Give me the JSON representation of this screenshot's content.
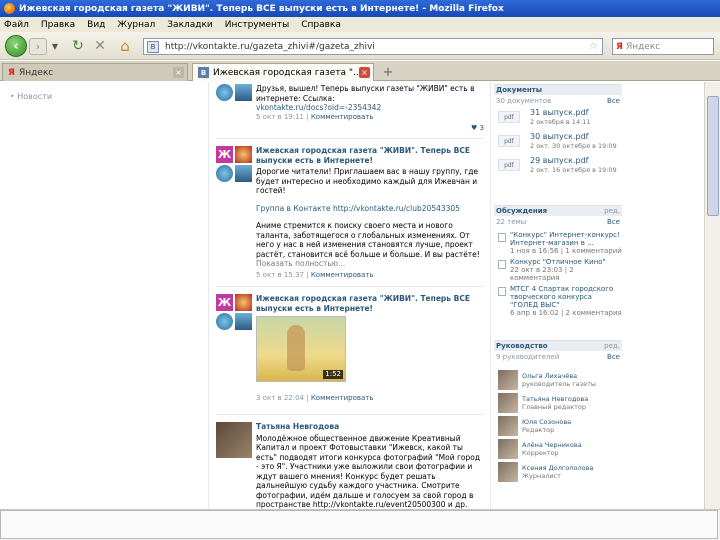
{
  "window": {
    "title": "Ижевская городская газета \"ЖИВИ\". Теперь ВСЕ выпуски есть в Интернете! - Mozilla Firefox"
  },
  "menu": [
    "Файл",
    "Правка",
    "Вид",
    "Журнал",
    "Закладки",
    "Инструменты",
    "Справка"
  ],
  "nav": {
    "url": "http://vkontakte.ru/gazeta_zhivi#/gazeta_zhivi",
    "search_placeholder": "Яндекс",
    "search_logo": "Я"
  },
  "tabs": [
    {
      "label": "Яндекс",
      "active": false
    },
    {
      "label": "Ижевская городская газета \"...",
      "active": true
    }
  ],
  "leftnav": {
    "label": "Новости"
  },
  "posts": [
    {
      "author": "",
      "text": "Друзья, вышел! Теперь выпуски газеты \"ЖИВИ\" есть в интернете: Ссылка:",
      "link": "vkontakte.ru/docs?oid=-2354342",
      "meta_date": "5 окт в 19:11",
      "meta_action": "Комментировать",
      "likes": "3"
    },
    {
      "author": "Ижевская городская газета \"ЖИВИ\". Теперь ВСЕ выпуски есть в Интернете!",
      "text1": "Дорогие читатели! Приглашаем вас в нашу группу, где будет интересно и необходимо каждый для Ижевчан и гостей!",
      "text2": "Группа в Контакте http://vkontakte.ru/club20543305",
      "text3": "Аниме стремится к поиску своего места и нового таланта, заботящегося о глобальных изменениях. От него у нас в ней изменения становятся лучше, проект растёт, становится всё больше и больше. И вы растёте!",
      "more": "Показать полностью...",
      "meta_date": "5 окт в 15:37",
      "meta_action": "Комментировать"
    },
    {
      "author": "Ижевская городская газета \"ЖИВИ\". Теперь ВСЕ выпуски есть в Интернете!",
      "video_duration": "1:52",
      "meta_date": "3 окт в 22:04",
      "meta_action": "Комментировать"
    },
    {
      "author": "Татьяна Невгодова",
      "text": "Молодёжное общественное движение Креативный Капитал и проект Фотовыставки \"Ижевск, какой ты есть\" подводят итоги конкурса фотографий \"Мой город - это Я\". Участники уже выложили свои фотографии и ждут вашего мнения! Конкурс будет решать дальнейшую судьбу каждого участника. Смотрите фотографии, идём дальше и голосуем за свой город в пространстве http://vkontakte.ru/event20500300 и др.",
      "meta_date": "",
      "meta_action": ""
    }
  ],
  "sidebar": {
    "documents": {
      "title": "Документы",
      "all": "Все",
      "count": "30 документов",
      "items": [
        {
          "ext": "pdf",
          "name": "31 выпуск.pdf",
          "date": "2 октября в 14:11"
        },
        {
          "ext": "pdf",
          "name": "30 выпуск.pdf",
          "date": "2 окт. 30 октября в 19:09"
        },
        {
          "ext": "pdf",
          "name": "29 выпуск.pdf",
          "date": "2 окт. 16 октября в 19:09"
        }
      ]
    },
    "discussions": {
      "title": "Обсуждения",
      "action": "ред.",
      "count": "22 темы",
      "all": "Все",
      "items": [
        {
          "title": "\"Конкурс\" Интернет-конкурс!",
          "date": "Интернет-магазин в ...",
          "extra": "1 ноя в 16:56 | 1 комментарий"
        },
        {
          "title": "Конкурс \"Отличное Кино\"",
          "date": "22 окт в 23:03 | 2 комментария"
        },
        {
          "title": "МТСГ 4 Спартак городского творческого конкурса \"ГОЛЕД ВЫС\"",
          "date": "6 апр в 16:02 | 2 комментария"
        }
      ]
    },
    "leaders": {
      "title": "Руководство",
      "action": "ред.",
      "count": "9 руководителей",
      "all": "Все",
      "items": [
        {
          "name": "Ольга Лихачёва",
          "role": "руководитель газеты"
        },
        {
          "name": "Татьяна Невгодова",
          "role": "Главный редактор"
        },
        {
          "name": "Юля Созонова",
          "role": "Редактор"
        },
        {
          "name": "Алёна Черникова",
          "role": "Корректор"
        },
        {
          "name": "Ксения Долгополова",
          "role": "Журналист"
        }
      ]
    }
  },
  "colors": {
    "vk_blue": "#2b587a",
    "titlebar": "#2f6ad8"
  }
}
